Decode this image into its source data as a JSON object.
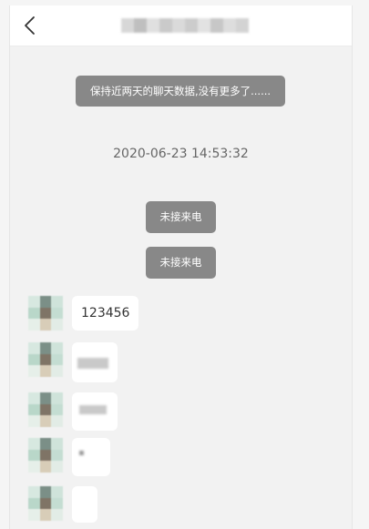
{
  "header": {
    "back_icon": "chevron-left-icon"
  },
  "notice": "保持近两天的聊天数据,没有更多了......",
  "timestamp": "2020-06-23 14:53:32",
  "missed_calls": [
    "未接来电",
    "未接来电"
  ],
  "messages": [
    {
      "text": "123456"
    }
  ],
  "colors": {
    "pill_bg": "#888888",
    "chat_bg": "#f2f2f2",
    "bubble_bg": "#ffffff",
    "avatar_pixels": [
      "#d7e8e0",
      "#7b8f87",
      "#cfe3da",
      "#b9d7c9",
      "#7f7466",
      "#c4ddd2",
      "#e6efe9",
      "#d8cdb8",
      "#e2ece6"
    ]
  }
}
